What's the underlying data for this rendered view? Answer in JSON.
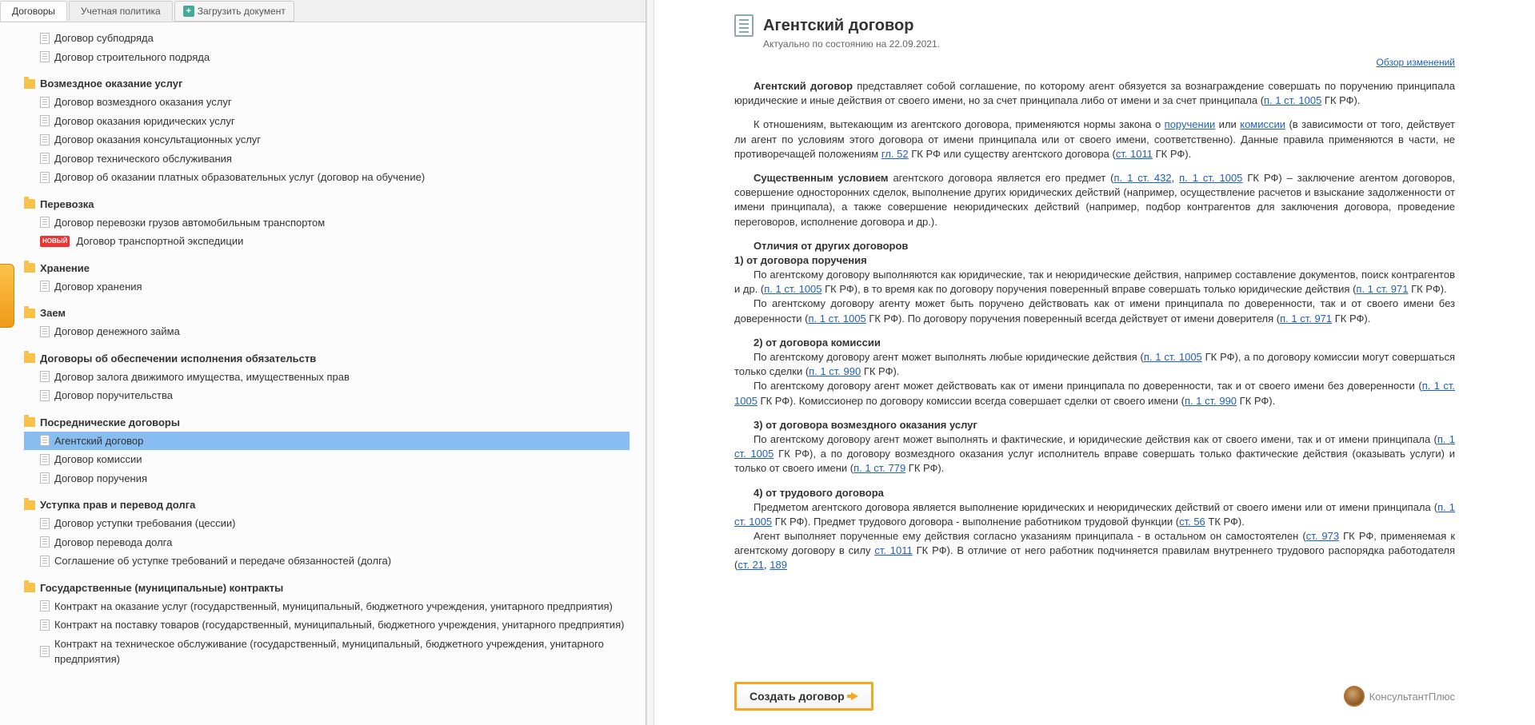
{
  "tabs": {
    "contracts": "Договоры",
    "policy": "Учетная политика",
    "upload": "Загрузить документ"
  },
  "tree": {
    "orphan_items": [
      "Договор субподряда",
      "Договор строительного подряда"
    ],
    "categories": [
      {
        "title": "Возмездное оказание услуг",
        "items": [
          "Договор возмездного оказания услуг",
          "Договор оказания юридических услуг",
          "Договор оказания консультационных услуг",
          "Договор технического обслуживания",
          "Договор об оказании платных образовательных услуг (договор на обучение)"
        ]
      },
      {
        "title": "Перевозка",
        "items": [
          "Договор перевозки грузов автомобильным транспортом",
          "Договор транспортной экспедиции"
        ],
        "new_idx": 1
      },
      {
        "title": "Хранение",
        "items": [
          "Договор хранения"
        ]
      },
      {
        "title": "Заем",
        "items": [
          "Договор денежного займа"
        ]
      },
      {
        "title": "Договоры об обеспечении исполнения обязательств",
        "items": [
          "Договор залога движимого имущества, имущественных прав",
          "Договор поручительства"
        ]
      },
      {
        "title": "Посреднические договоры",
        "items": [
          "Агентский договор",
          "Договор комиссии",
          "Договор поручения"
        ],
        "selected_idx": 0
      },
      {
        "title": "Уступка прав и перевод долга",
        "items": [
          "Договор уступки требования (цессии)",
          "Договор перевода долга",
          "Соглашение об уступке требований и передаче обязанностей (долга)"
        ]
      },
      {
        "title": "Государственные (муниципальные) контракты",
        "items": [
          "Контракт на оказание услуг (государственный, муниципальный, бюджетного учреждения, унитарного предприятия)",
          "Контракт на поставку товаров (государственный, муниципальный, бюджетного учреждения, унитарного предприятия)",
          "Контракт на техническое обслуживание (государственный, муниципальный, бюджетного учреждения, унитарного предприятия)"
        ]
      }
    ],
    "new_label": "НОВЫЙ"
  },
  "article": {
    "title": "Агентский договор",
    "meta": "Актуально по состоянию на 22.09.2021.",
    "changes_link": "Обзор изменений",
    "p1_b": "Агентский договор",
    "p1_a": " представляет собой соглашение, по которому агент обязуется за вознаграждение совершать по поручению принципала юридические и иные действия от своего имени, но за счет принципала либо от имени и за счет принципала (",
    "p1_l": "п. 1 ст. 1005",
    "p1_e": " ГК РФ).",
    "p2_a": "К отношениям, вытекающим из агентского договора, применяются нормы закона о ",
    "p2_l1": "поручении",
    "p2_b": " или ",
    "p2_l2": "комиссии",
    "p2_c": " (в зависимости от того, действует ли агент по условиям этого договора от имени принципала или от своего имени, соответственно). Данные правила применяются в части, не противоречащей положениям ",
    "p2_l3": "гл. 52",
    "p2_d": " ГК РФ или существу агентского договора (",
    "p2_l4": "ст. 1011",
    "p2_e": " ГК РФ).",
    "p3_b": "Существенным условием",
    "p3_a": " агентского договора является его предмет (",
    "p3_l1": "п. 1 ст. 432",
    "p3_c": ", ",
    "p3_l2": "п. 1 ст. 1005",
    "p3_d": " ГК РФ) – заключение агентом договоров, совершение односторонних сделок, выполнение других юридических действий (например, осуществление расчетов и взыскание задолженности от имени принципала), а также совершение неюридических действий (например, подбор контрагентов для заключения договора, проведение переговоров, исполнение договора и др.).",
    "h_diff": "Отличия от других договоров",
    "h1": "1) от договора поручения",
    "d1a_a": "По агентскому договору выполняются как юридические, так и неюридические действия, например составление документов, поиск контрагентов и др. (",
    "d1a_l": "п. 1 ст. 1005",
    "d1a_b": " ГК РФ),  в то время как по договору поручения поверенный вправе совершать только юридические действия (",
    "d1a_l2": "п. 1 ст. 971",
    "d1a_c": " ГК РФ).",
    "d1b_a": "По агентскому договору агенту может быть поручено действовать как от имени принципала по доверенности, так и от своего имени без доверенности (",
    "d1b_l": "п. 1 ст. 1005",
    "d1b_b": " ГК РФ). По договору поручения поверенный всегда действует от имени доверителя (",
    "d1b_l2": "п. 1 ст. 971",
    "d1b_c": " ГК РФ).",
    "h2": "2) от договора комиссии",
    "d2a_a": "По агентскому договору агент может выполнять любые юридические действия (",
    "d2a_l": "п. 1 ст. 1005",
    "d2a_b": " ГК РФ), а по договору комиссии могут совершаться только сделки (",
    "d2a_l2": "п. 1 ст. 990",
    "d2a_c": " ГК РФ).",
    "d2b_a": "По агентскому договору агент может действовать как от имени принципала по доверенности, так и от своего имени без доверенности (",
    "d2b_l": "п. 1 ст. 1005",
    "d2b_b": " ГК РФ). Комиссионер по договору комиссии всегда совершает сделки от своего имени (",
    "d2b_l2": "п. 1 ст. 990",
    "d2b_c": " ГК РФ).",
    "h3": "3) от договора возмездного оказания услуг",
    "d3_a": "По агентскому договору агент может выполнять и фактические, и юридические действия как от своего имени, так и от имени принципала (",
    "d3_l": "п. 1 ст. 1005",
    "d3_b": " ГК РФ), а по договору возмездного оказания услуг исполнитель вправе совершать только фактические действия (оказывать услуги) и только от своего имени (",
    "d3_l2": "п. 1 ст. 779",
    "d3_c": " ГК РФ).",
    "h4": "4) от трудового договора",
    "d4a_a": "Предметом агентского договора является выполнение юридических и неюридических действий от своего имени или от имени принципала (",
    "d4a_l": "п. 1 ст. 1005",
    "d4a_b": " ГК РФ). Предмет трудового договора - выполнение работником трудовой функции (",
    "d4a_l2": "ст. 56",
    "d4a_c": " ТК РФ).",
    "d4b_a": "Агент выполняет порученные ему действия согласно указаниям принципала - в остальном он самостоятелен (",
    "d4b_l": "ст. 973",
    "d4b_b": " ГК РФ, применяемая к агентскому договору в силу ",
    "d4b_l2": "ст. 1011",
    "d4b_c": " ГК РФ). В отличие от него работник подчиняется правилам внутреннего трудового распорядка работодателя (",
    "d4b_l3": "ст. 21",
    "d4b_d": ", ",
    "d4b_l4": "189"
  },
  "create_btn": "Создать договор",
  "brand": "КонсультантПлюс"
}
